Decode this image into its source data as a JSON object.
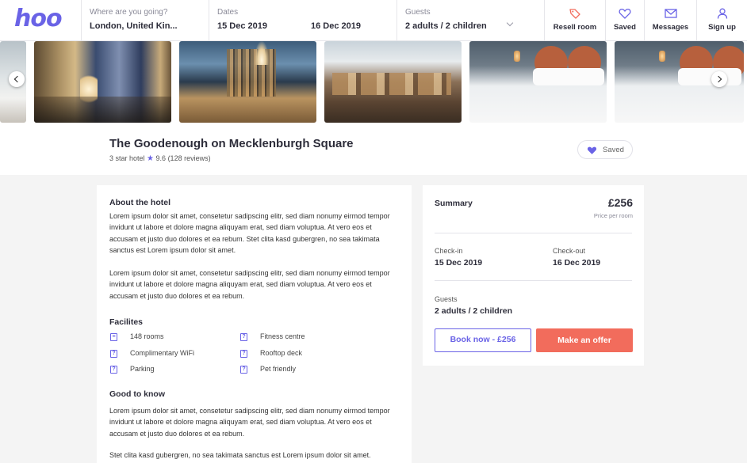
{
  "brand": {
    "logo_text": "hoo",
    "accent": "#6a63e6",
    "offer_color": "#f26c5c"
  },
  "search": {
    "destination": {
      "label": "Where are you going?",
      "value": "London, United Kin..."
    },
    "dates": {
      "label": "Dates",
      "checkin": "15 Dec 2019",
      "checkout": "16 Dec 2019"
    },
    "guests": {
      "label": "Guests",
      "value": "2 adults / 2 children"
    }
  },
  "nav": [
    {
      "label": "Resell room",
      "icon": "tag-icon"
    },
    {
      "label": "Saved",
      "icon": "heart-icon"
    },
    {
      "label": "Messages",
      "icon": "envelope-icon"
    },
    {
      "label": "Sign up",
      "icon": "user-icon"
    }
  ],
  "hotel": {
    "name": "The Goodenough on Mecklenburgh Square",
    "stars_text": "3 star hotel",
    "rating": "9.6",
    "reviews": "(128 reviews)",
    "saved_label": "Saved"
  },
  "about": {
    "title": "About the hotel",
    "p1": "Lorem ipsum dolor sit amet, consetetur sadipscing elitr, sed diam nonumy eirmod tempor invidunt ut labore et dolore magna aliquyam erat, sed diam voluptua. At vero eos et accusam et justo duo dolores et ea rebum. Stet clita kasd gubergren, no sea takimata sanctus est Lorem ipsum dolor sit amet.",
    "p2": "Lorem ipsum dolor sit amet, consetetur sadipscing elitr, sed diam nonumy eirmod tempor invidunt ut labore et dolore magna aliquyam erat, sed diam voluptua. At vero eos et accusam et justo duo dolores et ea rebum.",
    "facilities_title": "Facilites",
    "facilities": [
      "148 rooms",
      "Fitness centre",
      "Complimentary WiFi",
      "Rooftop deck",
      "Parking",
      "Pet friendly"
    ],
    "good_title": "Good to know",
    "good_p1": "Lorem ipsum dolor sit amet, consetetur sadipscing elitr, sed diam nonumy eirmod tempor invidunt ut labore et dolore magna aliquyam erat, sed diam voluptua. At vero eos et accusam et justo duo dolores et ea rebum.",
    "good_p2": "Stet clita kasd gubergren, no sea takimata sanctus est Lorem ipsum dolor sit amet."
  },
  "summary": {
    "title": "Summary",
    "price": "£256",
    "price_note": "Price per room",
    "checkin_label": "Check-in",
    "checkin": "15 Dec 2019",
    "checkout_label": "Check-out",
    "checkout": "16 Dec 2019",
    "guests_label": "Guests",
    "guests": "2 adults / 2 children",
    "book_label": "Book now - £256",
    "offer_label": "Make an offer"
  }
}
